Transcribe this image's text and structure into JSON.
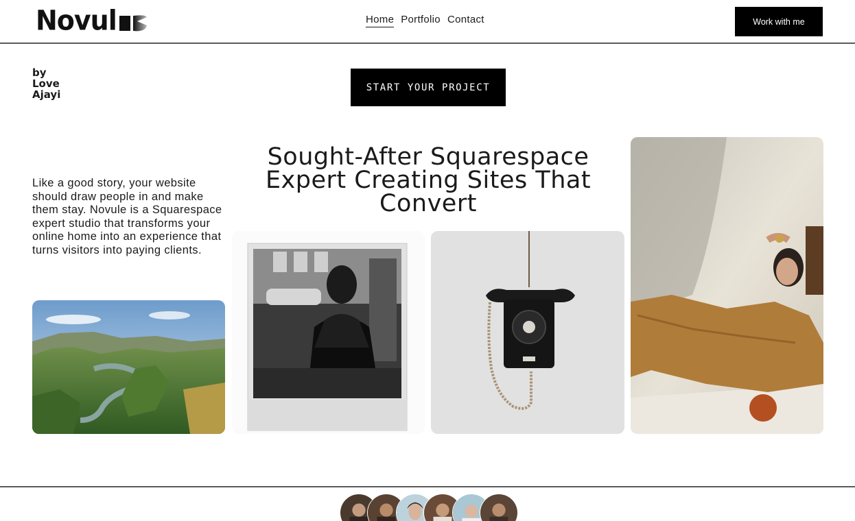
{
  "header": {
    "logo_text": "Novul",
    "nav": [
      {
        "label": "Home",
        "active": true
      },
      {
        "label": "Portfolio",
        "active": false
      },
      {
        "label": "Contact",
        "active": false
      }
    ],
    "cta_label": "Work with me"
  },
  "hero": {
    "byline": [
      "by",
      "Love",
      "Ajayi"
    ],
    "start_button": "START YOUR PROJECT",
    "headline_lines": [
      "Sought-After Squarespace",
      "Expert Creating Sites That",
      "Convert"
    ],
    "intro": "Like a good story, your website should draw people in and make them stay. Novule is a Squarespace expert studio that transforms your online home into an experience that turns visitors into paying clients."
  },
  "gallery": [
    {
      "name": "canyon-landscape-photo"
    },
    {
      "name": "polaroid-portrait-photo"
    },
    {
      "name": "rotary-telephone-photo"
    },
    {
      "name": "woman-reclining-photo"
    }
  ],
  "colors": {
    "primary": "#000000",
    "background": "#ffffff",
    "divider": "#5a5a5a",
    "text": "#1a1a1a"
  }
}
